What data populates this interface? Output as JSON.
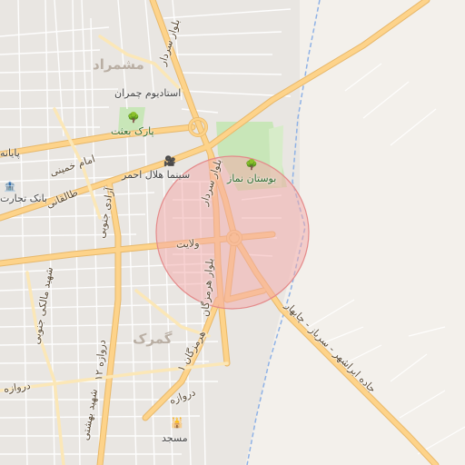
{
  "map": {
    "districts": {
      "moshmerad": "مشمراد",
      "gomrok": "گمرک"
    },
    "roads": {
      "sardar": "بلوار سردار",
      "hormozgan": "بلوار هرمزگان",
      "hormozgan2": "هرمزگان ۱",
      "emam_khomeini": "امام خمینی",
      "taleghani": "طالقانی",
      "azadi_jonoobi": "آزادی جنوبی",
      "velayat": "ولایت",
      "shahid_maleki": "شهید مالکی جنوبی",
      "shahid_beheshti": "شهید بهشتی",
      "dorwazeh": "دروازه ۱۲",
      "dorwazeh_a": "دروازه",
      "dorwazeh_b": "دروازه",
      "jadeh": "جاده ابراشهر - سرباز - چابهار"
    },
    "pois": {
      "stadium": "استادیوم چمران",
      "park_besat": "پارک بعثت",
      "bostan_namaz": "بوستان نماز",
      "cinema": "سینما هلال احمر",
      "bank": "بانک تجارت",
      "terminal": "پایانه",
      "mosque": "مسجد"
    },
    "icons": {
      "park_besat_icon": "tree-icon",
      "bostan_icon": "tree-icon",
      "cinema_icon": "camera-icon",
      "bank_icon": "bank-icon",
      "mosque_icon": "mosque-icon"
    },
    "colors": {
      "background": "#f2efe9",
      "major_road": "#fdd38a",
      "park": "#c8e6b8",
      "highlight": "#f4a7a7",
      "river": "#8fb2e6"
    }
  }
}
